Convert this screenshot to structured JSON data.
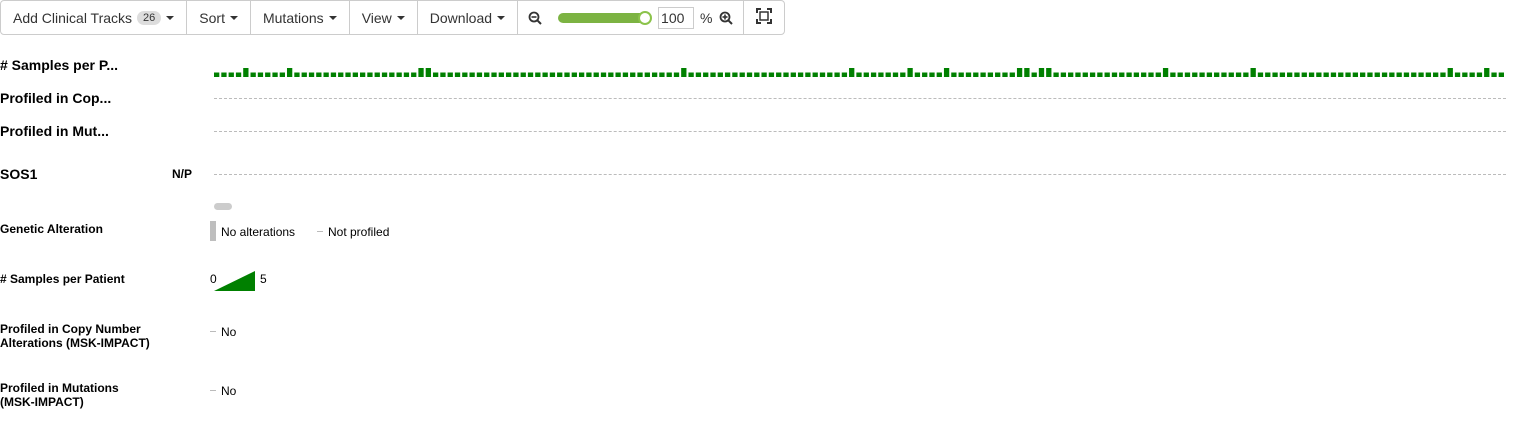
{
  "toolbar": {
    "add_tracks_label": "Add Clinical Tracks",
    "add_tracks_count": "26",
    "sort_label": "Sort",
    "mutations_label": "Mutations",
    "view_label": "View",
    "download_label": "Download",
    "zoom_value": "100",
    "zoom_unit": "%",
    "zoom_slider_fraction": 0.95
  },
  "tracks": {
    "samples_per_patient": "# Samples per P...",
    "profiled_cna": "Profiled in Cop...",
    "profiled_mut": "Profiled in Mut...",
    "gene": "SOS1",
    "gene_status": "N/P"
  },
  "samples_per_patient_values": [
    1,
    1,
    1,
    1,
    2,
    1,
    1,
    1,
    1,
    1,
    2,
    1,
    1,
    1,
    1,
    1,
    1,
    1,
    1,
    1,
    1,
    1,
    1,
    1,
    1,
    1,
    1,
    1,
    2,
    2,
    1,
    1,
    1,
    1,
    1,
    1,
    1,
    1,
    1,
    1,
    1,
    1,
    1,
    1,
    1,
    1,
    1,
    1,
    1,
    1,
    1,
    1,
    1,
    1,
    1,
    1,
    1,
    1,
    1,
    1,
    1,
    1,
    1,
    1,
    2,
    1,
    1,
    1,
    1,
    1,
    1,
    1,
    1,
    1,
    1,
    1,
    1,
    1,
    1,
    1,
    1,
    1,
    1,
    1,
    1,
    1,
    1,
    2,
    1,
    1,
    1,
    1,
    1,
    1,
    1,
    2,
    1,
    1,
    1,
    1,
    2,
    1,
    1,
    1,
    1,
    1,
    1,
    1,
    1,
    1,
    2,
    2,
    1,
    2,
    2,
    1,
    1,
    1,
    1,
    1,
    1,
    1,
    1,
    1,
    1,
    1,
    1,
    1,
    1,
    1,
    2,
    1,
    1,
    1,
    1,
    1,
    1,
    1,
    1,
    1,
    1,
    1,
    2,
    1,
    1,
    1,
    1,
    1,
    1,
    1,
    1,
    1,
    1,
    1,
    1,
    1,
    1,
    1,
    1,
    1,
    1,
    1,
    1,
    1,
    1,
    1,
    1,
    1,
    1,
    2,
    1,
    1,
    1,
    1,
    2,
    1,
    1
  ],
  "legend": {
    "genetic_alteration_title": "Genetic Alteration",
    "no_alterations": "No alterations",
    "not_profiled": "Not profiled",
    "samples_title": "# Samples per Patient",
    "samples_min": "0",
    "samples_max": "5",
    "cna_title_line1": "Profiled in Copy Number",
    "cna_title_line2": "Alterations (MSK-IMPACT)",
    "cna_value": "No",
    "mut_title_line1": "Profiled in Mutations",
    "mut_title_line2": "(MSK-IMPACT)",
    "mut_value": "No"
  },
  "colors": {
    "samples_bar": "#008000",
    "no_alteration": "#bebebe",
    "slider": "#7cb342"
  }
}
